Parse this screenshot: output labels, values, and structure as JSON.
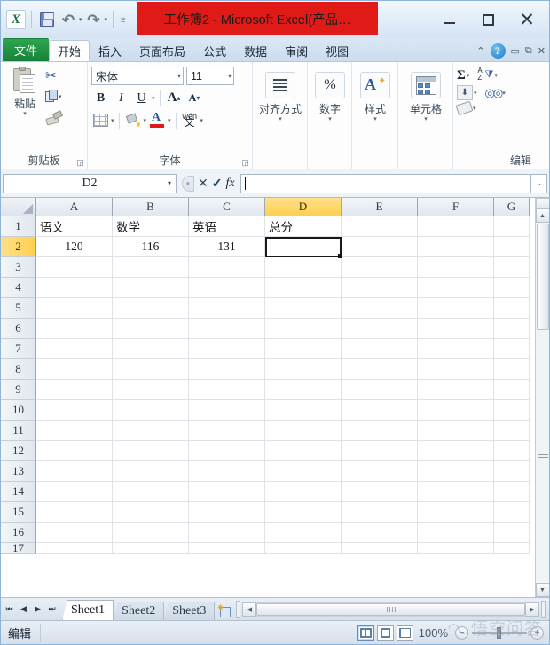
{
  "window": {
    "title": "工作簿2 - Microsoft Excel(产品…",
    "title_highlight_color": "#e01b17",
    "minimize_label": "最小化",
    "maximize_label": "最大化",
    "close_label": "关闭"
  },
  "quick_access": {
    "app_logo": "excel-logo",
    "items": [
      {
        "name": "save-icon",
        "label": "保存"
      },
      {
        "name": "undo-icon",
        "label": "撤消"
      },
      {
        "name": "redo-icon",
        "label": "恢复"
      },
      {
        "name": "customize-qat-icon",
        "label": "自定义快速访问工具栏"
      }
    ]
  },
  "ribbon": {
    "tabs": [
      {
        "label": "文件",
        "active": false,
        "is_file": true
      },
      {
        "label": "开始",
        "active": true,
        "is_file": false
      },
      {
        "label": "插入",
        "active": false,
        "is_file": false
      },
      {
        "label": "页面布局",
        "active": false,
        "is_file": false
      },
      {
        "label": "公式",
        "active": false,
        "is_file": false
      },
      {
        "label": "数据",
        "active": false,
        "is_file": false
      },
      {
        "label": "审阅",
        "active": false,
        "is_file": false
      },
      {
        "label": "视图",
        "active": false,
        "is_file": false
      }
    ],
    "help_label": "?",
    "minimize_ribbon_label": "最小化功能区",
    "groups": {
      "clipboard": {
        "label": "剪贴板",
        "paste_label": "粘贴",
        "cut_label": "剪切",
        "copy_label": "复制",
        "format_painter_label": "格式刷"
      },
      "font": {
        "label": "字体",
        "font_name": "宋体",
        "font_size": "11",
        "bold_label": "B",
        "italic_label": "I",
        "underline_label": "U",
        "grow_font_label": "A",
        "shrink_font_label": "A",
        "borders_label": "边框",
        "fill_color_label": "填充颜色",
        "font_color_label": "字体颜色",
        "font_color_value": "#e01b17",
        "phonetic_top": "wén",
        "phonetic_bottom": "文"
      },
      "alignment": {
        "label": "对齐方式"
      },
      "number": {
        "label": "数字",
        "percent_label": "%"
      },
      "styles": {
        "label": "样式"
      },
      "cells": {
        "label": "单元格"
      },
      "editing": {
        "label": "编辑",
        "autosum_label": "Σ",
        "sort_filter_label": "排序和筛选",
        "fill_label": "填充",
        "find_select_label": "查找和选择",
        "clear_label": "清除"
      }
    }
  },
  "formula_bar": {
    "name_box_value": "D2",
    "cancel_label": "✕",
    "enter_label": "✓",
    "insert_function_label": "fx",
    "formula_value": "",
    "expand_label": "⌄"
  },
  "grid": {
    "columns": [
      "A",
      "B",
      "C",
      "D",
      "E",
      "F",
      "G"
    ],
    "selected_column": "D",
    "selected_row": "2",
    "active_cell": "D2",
    "rows": [
      {
        "num": "1",
        "cells": [
          "语文",
          "数学",
          "英语",
          "总分",
          "",
          "",
          ""
        ]
      },
      {
        "num": "2",
        "cells": [
          "120",
          "116",
          "131",
          "",
          "",
          "",
          ""
        ]
      },
      {
        "num": "3",
        "cells": [
          "",
          "",
          "",
          "",
          "",
          "",
          ""
        ]
      },
      {
        "num": "4",
        "cells": [
          "",
          "",
          "",
          "",
          "",
          "",
          ""
        ]
      },
      {
        "num": "5",
        "cells": [
          "",
          "",
          "",
          "",
          "",
          "",
          ""
        ]
      },
      {
        "num": "6",
        "cells": [
          "",
          "",
          "",
          "",
          "",
          "",
          ""
        ]
      },
      {
        "num": "7",
        "cells": [
          "",
          "",
          "",
          "",
          "",
          "",
          ""
        ]
      },
      {
        "num": "8",
        "cells": [
          "",
          "",
          "",
          "",
          "",
          "",
          ""
        ]
      },
      {
        "num": "9",
        "cells": [
          "",
          "",
          "",
          "",
          "",
          "",
          ""
        ]
      },
      {
        "num": "10",
        "cells": [
          "",
          "",
          "",
          "",
          "",
          "",
          ""
        ]
      },
      {
        "num": "11",
        "cells": [
          "",
          "",
          "",
          "",
          "",
          "",
          ""
        ]
      },
      {
        "num": "12",
        "cells": [
          "",
          "",
          "",
          "",
          "",
          "",
          ""
        ]
      },
      {
        "num": "13",
        "cells": [
          "",
          "",
          "",
          "",
          "",
          "",
          ""
        ]
      },
      {
        "num": "14",
        "cells": [
          "",
          "",
          "",
          "",
          "",
          "",
          ""
        ]
      },
      {
        "num": "15",
        "cells": [
          "",
          "",
          "",
          "",
          "",
          "",
          ""
        ]
      },
      {
        "num": "16",
        "cells": [
          "",
          "",
          "",
          "",
          "",
          "",
          ""
        ]
      },
      {
        "num": "17",
        "cells": [
          "",
          "",
          "",
          "",
          "",
          "",
          ""
        ]
      }
    ]
  },
  "sheet_tabs": {
    "first_label": "⏮",
    "prev_label": "◀",
    "next_label": "▶",
    "last_label": "⏭",
    "sheets": [
      {
        "label": "Sheet1",
        "active": true
      },
      {
        "label": "Sheet2",
        "active": false
      },
      {
        "label": "Sheet3",
        "active": false
      }
    ],
    "insert_sheet_label": "插入工作表"
  },
  "status_bar": {
    "mode": "编辑",
    "view_normal_label": "普通",
    "view_layout_label": "页面布局",
    "view_break_label": "分页预览",
    "zoom": "100%",
    "zoom_out_label": "−",
    "zoom_in_label": "+"
  },
  "watermark": {
    "logo": "wukong-logo",
    "text": "悟空问答"
  }
}
